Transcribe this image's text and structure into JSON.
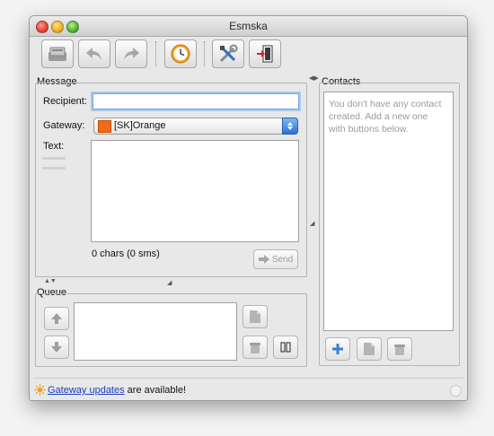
{
  "window": {
    "title": "Esmska"
  },
  "toolbar": {
    "buttons": [
      {
        "name": "compose-icon"
      },
      {
        "name": "undo-icon"
      },
      {
        "name": "redo-icon"
      },
      {
        "name": "history-clock-icon"
      },
      {
        "name": "settings-tools-icon"
      },
      {
        "name": "quit-exit-icon"
      }
    ]
  },
  "message": {
    "group_label": "Message",
    "recipient_label": "Recipient:",
    "recipient_value": "",
    "gateway_label": "Gateway:",
    "gateway_value": "[SK]Orange",
    "text_label": "Text:",
    "text_value": "",
    "chars_status": "0 chars (0 sms)",
    "send_label": "Send"
  },
  "queue": {
    "group_label": "Queue"
  },
  "contacts": {
    "group_label": "Contacts",
    "empty_message": "You don't have any contact created. Add a new one with buttons below."
  },
  "status": {
    "link_text": "Gateway updates",
    "suffix_text": " are available!"
  },
  "colors": {
    "link": "#1a3cc0",
    "gateway_flag": "#f36a10",
    "focus_ring": "#a9c8ef"
  }
}
